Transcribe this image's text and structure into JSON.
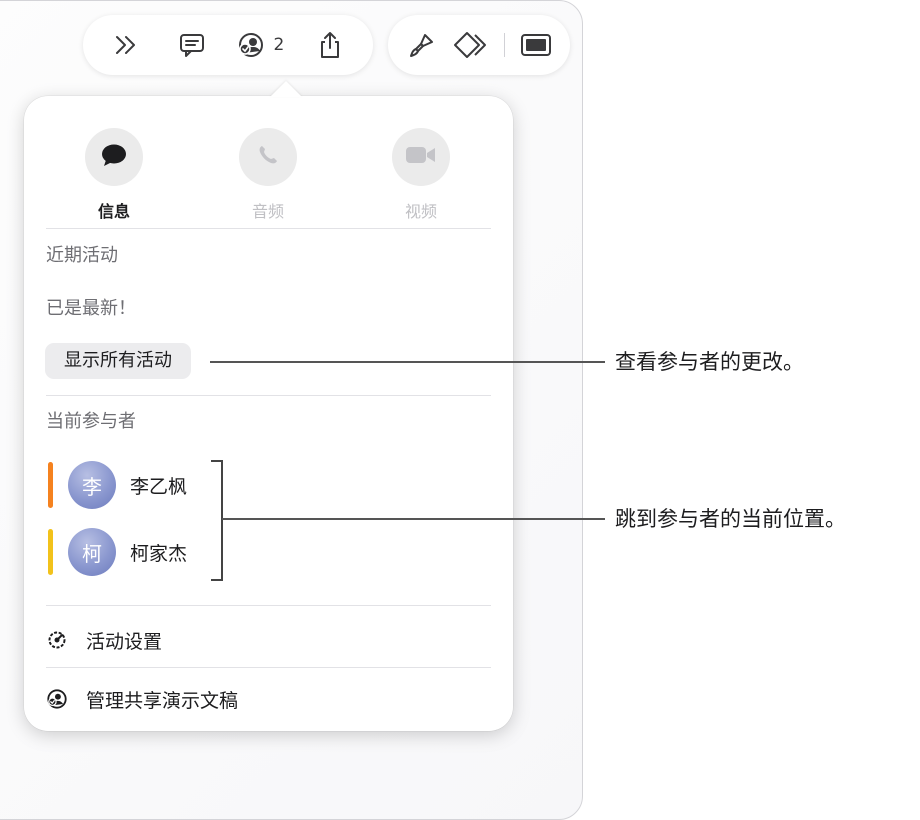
{
  "toolbar": {
    "expand_icon": "chevron-double-right-icon",
    "comment_icon": "comment-icon",
    "collaboration_icon": "collaboration-icon",
    "collaborator_count": "2",
    "share_icon": "share-icon",
    "format_icon": "paintbrush-icon",
    "animate_icon": "animate-diamond-icon",
    "document_icon": "document-panel-icon"
  },
  "popover": {
    "communication": [
      {
        "label": "信息",
        "icon": "message-bubble-icon",
        "enabled": true
      },
      {
        "label": "音频",
        "icon": "phone-icon",
        "enabled": false
      },
      {
        "label": "视频",
        "icon": "video-camera-icon",
        "enabled": false
      }
    ],
    "recent_activity": {
      "title": "近期活动",
      "status": "已是最新！",
      "show_all_label": "显示所有活动"
    },
    "participants": {
      "title": "当前参与者",
      "list": [
        {
          "initial": "李",
          "name": "李乙枫",
          "color": "#f5821f"
        },
        {
          "initial": "柯",
          "name": "柯家杰",
          "color": "#f2c21b"
        }
      ]
    },
    "menu": [
      {
        "label": "活动设置",
        "icon": "activity-settings-icon"
      },
      {
        "label": "管理共享演示文稿",
        "icon": "manage-share-icon"
      }
    ]
  },
  "callouts": [
    {
      "text": "查看参与者的更改。"
    },
    {
      "text": "跳到参与者的当前位置。"
    }
  ]
}
